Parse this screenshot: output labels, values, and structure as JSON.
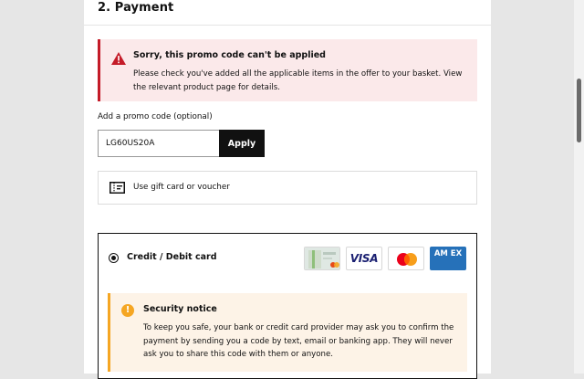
{
  "section": {
    "title": "2. Payment"
  },
  "error": {
    "title": "Sorry, this promo code can't be applied",
    "message": "Please check you've added all the applicable items in the offer to your basket. View the relevant product page for details.",
    "icon": "warning-triangle-icon",
    "color": "#c41b28"
  },
  "promo": {
    "label": "Add a promo code (optional)",
    "value": "LG60US20A",
    "apply_label": "Apply"
  },
  "gift": {
    "label": "Use gift card or voucher",
    "icon": "gift-card-icon"
  },
  "payment_method": {
    "label": "Credit / Debit card",
    "selected": true,
    "card_logos": [
      "generic-card",
      "visa",
      "mastercard",
      "american-express"
    ],
    "visa_text": "VISA",
    "amex_text": "AM EX"
  },
  "security": {
    "title": "Security notice",
    "message": "To keep you safe, your bank or credit card provider may ask you to confirm the payment by sending you a code by text, email or banking app. They will never ask you to share this code with them or anyone.",
    "icon": "exclamation-icon",
    "color": "#f5a623"
  }
}
